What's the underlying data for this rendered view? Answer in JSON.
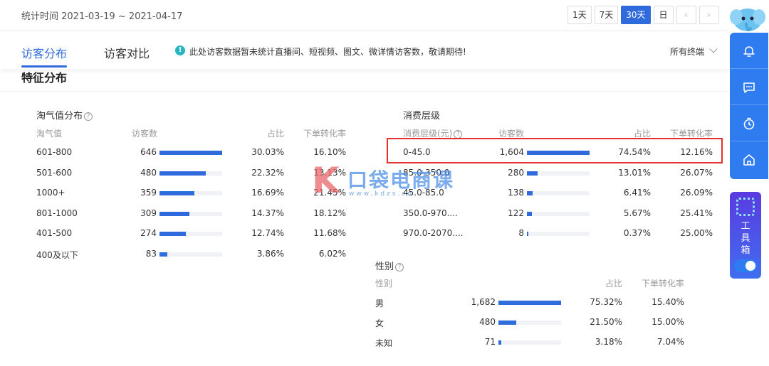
{
  "header": {
    "stat_time": "统计时间 2021-03-19 ~ 2021-04-17",
    "ranges": [
      "1天",
      "7天",
      "30天",
      "日"
    ],
    "active_range": "30天",
    "prev_icon": "chevron-left-icon",
    "next_icon": "chevron-right-icon"
  },
  "tabs": {
    "items": [
      "访客分布",
      "访客对比"
    ],
    "active": "访客分布",
    "notice": "此处访客数据暂未统计直播间、短视频、图文、微详情访客数，敬请期待!",
    "terminal": "所有终端"
  },
  "section_title": "特征分布",
  "taoqi": {
    "title": "淘气值分布",
    "headers": [
      "淘气值",
      "访客数",
      "占比",
      "下单转化率"
    ],
    "max": 646,
    "rows": [
      {
        "label": "601-800",
        "visitors": "646",
        "value": 646,
        "share": "30.03%",
        "conv": "16.10%"
      },
      {
        "label": "501-600",
        "visitors": "480",
        "value": 480,
        "share": "22.32%",
        "conv": "13.13%"
      },
      {
        "label": "1000+",
        "visitors": "359",
        "value": 359,
        "share": "16.69%",
        "conv": "21.45%"
      },
      {
        "label": "801-1000",
        "visitors": "309",
        "value": 309,
        "share": "14.37%",
        "conv": "18.12%"
      },
      {
        "label": "401-500",
        "visitors": "274",
        "value": 274,
        "share": "12.74%",
        "conv": "11.68%"
      },
      {
        "label": "400及以下",
        "visitors": "83",
        "value": 83,
        "share": "3.86%",
        "conv": "6.02%"
      }
    ]
  },
  "consume": {
    "title": "消费层级",
    "headers": [
      "消费层级(元)",
      "访客数",
      "占比",
      "下单转化率"
    ],
    "max": 1604,
    "rows": [
      {
        "label": "0-45.0",
        "visitors": "1,604",
        "value": 1604,
        "share": "74.54%",
        "conv": "12.16%"
      },
      {
        "label": "85.0-350.0",
        "visitors": "280",
        "value": 280,
        "share": "13.01%",
        "conv": "26.07%"
      },
      {
        "label": "45.0-85.0",
        "visitors": "138",
        "value": 138,
        "share": "6.41%",
        "conv": "26.09%"
      },
      {
        "label": "350.0-970....",
        "visitors": "122",
        "value": 122,
        "share": "5.67%",
        "conv": "25.41%"
      },
      {
        "label": "970.0-2070....",
        "visitors": "8",
        "value": 8,
        "share": "0.37%",
        "conv": "25.00%"
      }
    ]
  },
  "gender": {
    "title": "性别",
    "headers": [
      "性别",
      "占比",
      "下单转化率"
    ],
    "max": 1682,
    "rows": [
      {
        "label": "男",
        "visitors": "1,682",
        "value": 1682,
        "share": "75.32%",
        "conv": "15.40%"
      },
      {
        "label": "女",
        "visitors": "480",
        "value": 480,
        "share": "21.50%",
        "conv": "15.00%"
      },
      {
        "label": "未知",
        "visitors": "71",
        "value": 71,
        "share": "3.18%",
        "conv": "7.04%"
      }
    ]
  },
  "watermark": {
    "mark": "K",
    "text": "口袋电商课",
    "url": "www.kdzs.cn"
  },
  "sidebar": {
    "icons": [
      "bell-icon",
      "message-icon",
      "timer-icon",
      "home-icon"
    ],
    "toolbox_label": "工具箱",
    "toggle_on": true
  },
  "colors": {
    "accent": "#2f6bdc",
    "highlight": "#e5302b",
    "sidebar": "#2f7cf0"
  }
}
